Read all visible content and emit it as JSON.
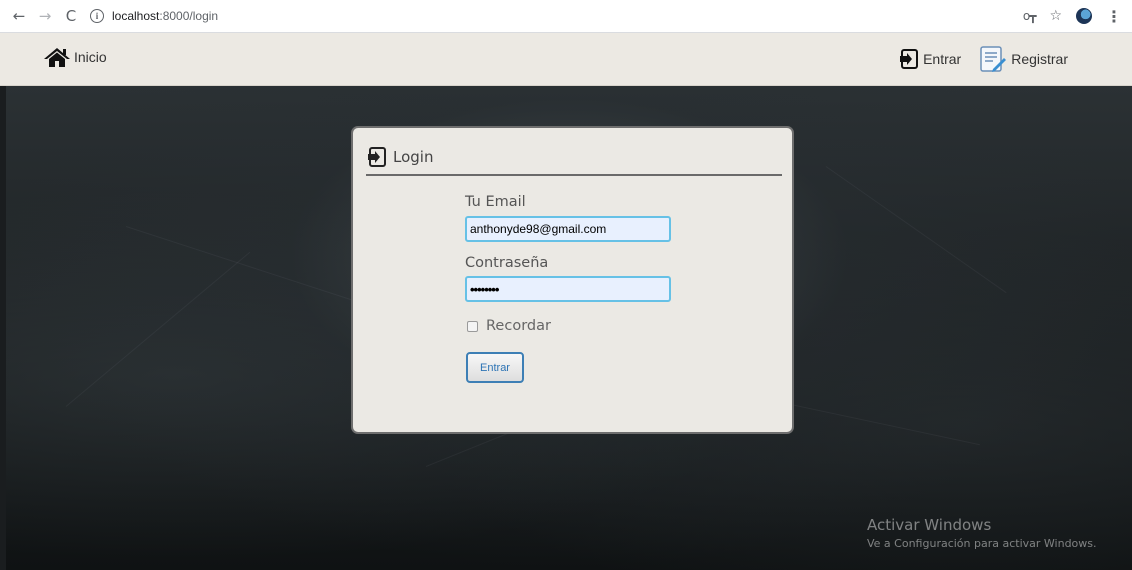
{
  "browser": {
    "url_host": "localhost",
    "url_path": ":8000/login"
  },
  "navbar": {
    "home_label": "Inicio",
    "login_label": "Entrar",
    "register_label": "Registrar"
  },
  "login_card": {
    "title": "Login",
    "email_label": "Tu Email",
    "email_value": "anthonyde98@gmail.com",
    "password_label": "Contraseña",
    "password_value": "••••••••",
    "remember_label": "Recordar",
    "remember_checked": false,
    "submit_label": "Entrar"
  },
  "watermark": {
    "title": "Activar Windows",
    "subtitle": "Ve a Configuración para activar Windows."
  },
  "colors": {
    "field_border": "#66c1e6",
    "button_border": "#3d7fb5",
    "card_bg": "#ebe9e4",
    "navbar_bg": "#ece9e3"
  }
}
